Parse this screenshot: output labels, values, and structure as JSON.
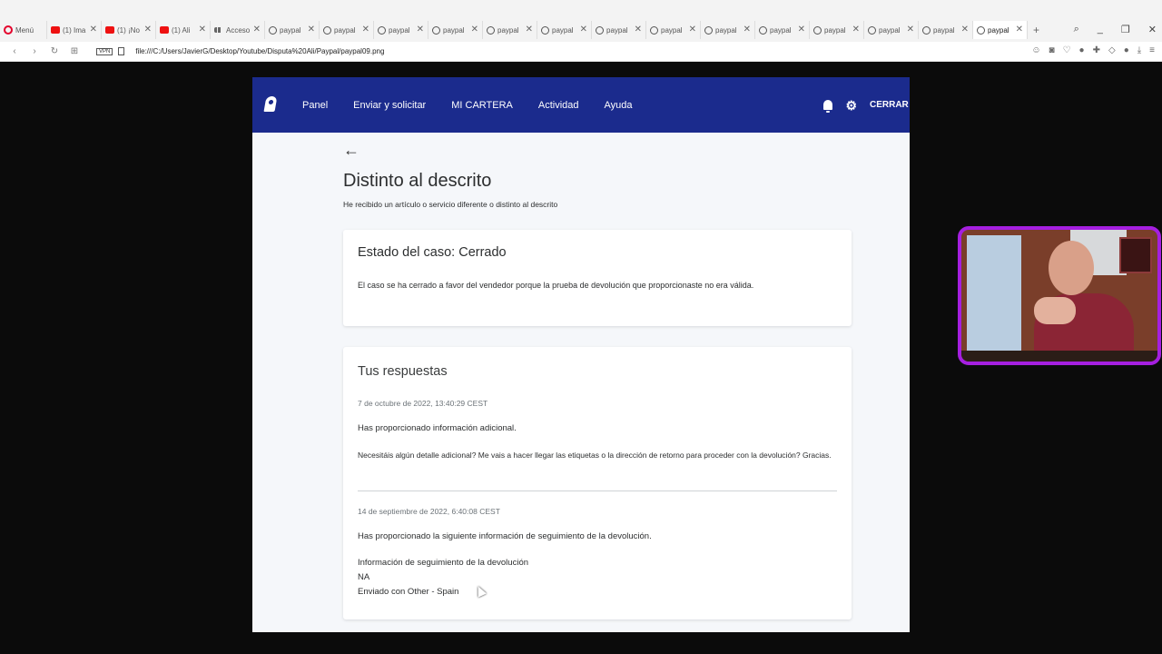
{
  "browser": {
    "tabs": [
      {
        "label": "Menú",
        "icon": "opera-icon",
        "kind": "menu"
      },
      {
        "label": "(1) Ima",
        "icon": "youtube-icon",
        "kind": "yt"
      },
      {
        "label": "(1) ¡No",
        "icon": "youtube-icon",
        "kind": "yt"
      },
      {
        "label": "(1) Ali",
        "icon": "youtube-icon",
        "kind": "yt"
      },
      {
        "label": "Acceso",
        "icon": "grid-icon",
        "kind": "grid"
      },
      {
        "label": "paypal",
        "icon": "globe-icon",
        "kind": "globe"
      },
      {
        "label": "paypal",
        "icon": "globe-icon",
        "kind": "globe"
      },
      {
        "label": "paypal",
        "icon": "globe-icon",
        "kind": "globe"
      },
      {
        "label": "paypal",
        "icon": "globe-icon",
        "kind": "globe"
      },
      {
        "label": "paypal",
        "icon": "globe-icon",
        "kind": "globe"
      },
      {
        "label": "paypal",
        "icon": "globe-icon",
        "kind": "globe"
      },
      {
        "label": "paypal",
        "icon": "globe-icon",
        "kind": "globe"
      },
      {
        "label": "paypal",
        "icon": "globe-icon",
        "kind": "globe"
      },
      {
        "label": "paypal",
        "icon": "globe-icon",
        "kind": "globe"
      },
      {
        "label": "paypal",
        "icon": "globe-icon",
        "kind": "globe"
      },
      {
        "label": "paypal",
        "icon": "globe-icon",
        "kind": "globe"
      },
      {
        "label": "paypal",
        "icon": "globe-icon",
        "kind": "globe"
      },
      {
        "label": "paypal",
        "icon": "globe-icon",
        "kind": "globe"
      },
      {
        "label": "paypal",
        "icon": "globe-icon",
        "kind": "globe",
        "active": true
      }
    ],
    "vpn_label": "VPN",
    "url": "file:///C:/Users/JavierG/Desktop/Youtube/Disputa%20Ali/Paypal/paypal09.png"
  },
  "paypal": {
    "nav": {
      "links": [
        "Panel",
        "Enviar y solicitar",
        "MI CARTERA",
        "Actividad",
        "Ayuda"
      ],
      "logout": "CERRAR SESIÓN"
    },
    "page_title": "Distinto al descrito",
    "subtitle": "He recibido un artículo o servicio diferente o distinto al descrito",
    "status_card": {
      "title": "Estado del caso: Cerrado",
      "text": "El caso se ha cerrado a favor del vendedor porque la prueba de devolución que proporcionaste no era válida."
    },
    "responses": {
      "title": "Tus respuestas",
      "items": [
        {
          "date": "7 de octubre de 2022, 13:40:29 CEST",
          "heading": "Has proporcionado información adicional.",
          "body": "Necesitáis algún detalle adicional? Me vais a hacer llegar las etiquetas o la dirección de retorno para proceder con la devolución? Gracias."
        },
        {
          "date": "14 de septiembre de 2022, 6:40:08 CEST",
          "heading": "Has proporcionado la siguiente información de seguimiento de la devolución.",
          "tracking_label": "Información de seguimiento de la devolución",
          "tracking_number": "NA",
          "carrier": "Enviado con Other - Spain"
        }
      ]
    }
  },
  "colors": {
    "paypal_nav": "#1b2b8d",
    "webcam_border": "#a51fe0"
  }
}
